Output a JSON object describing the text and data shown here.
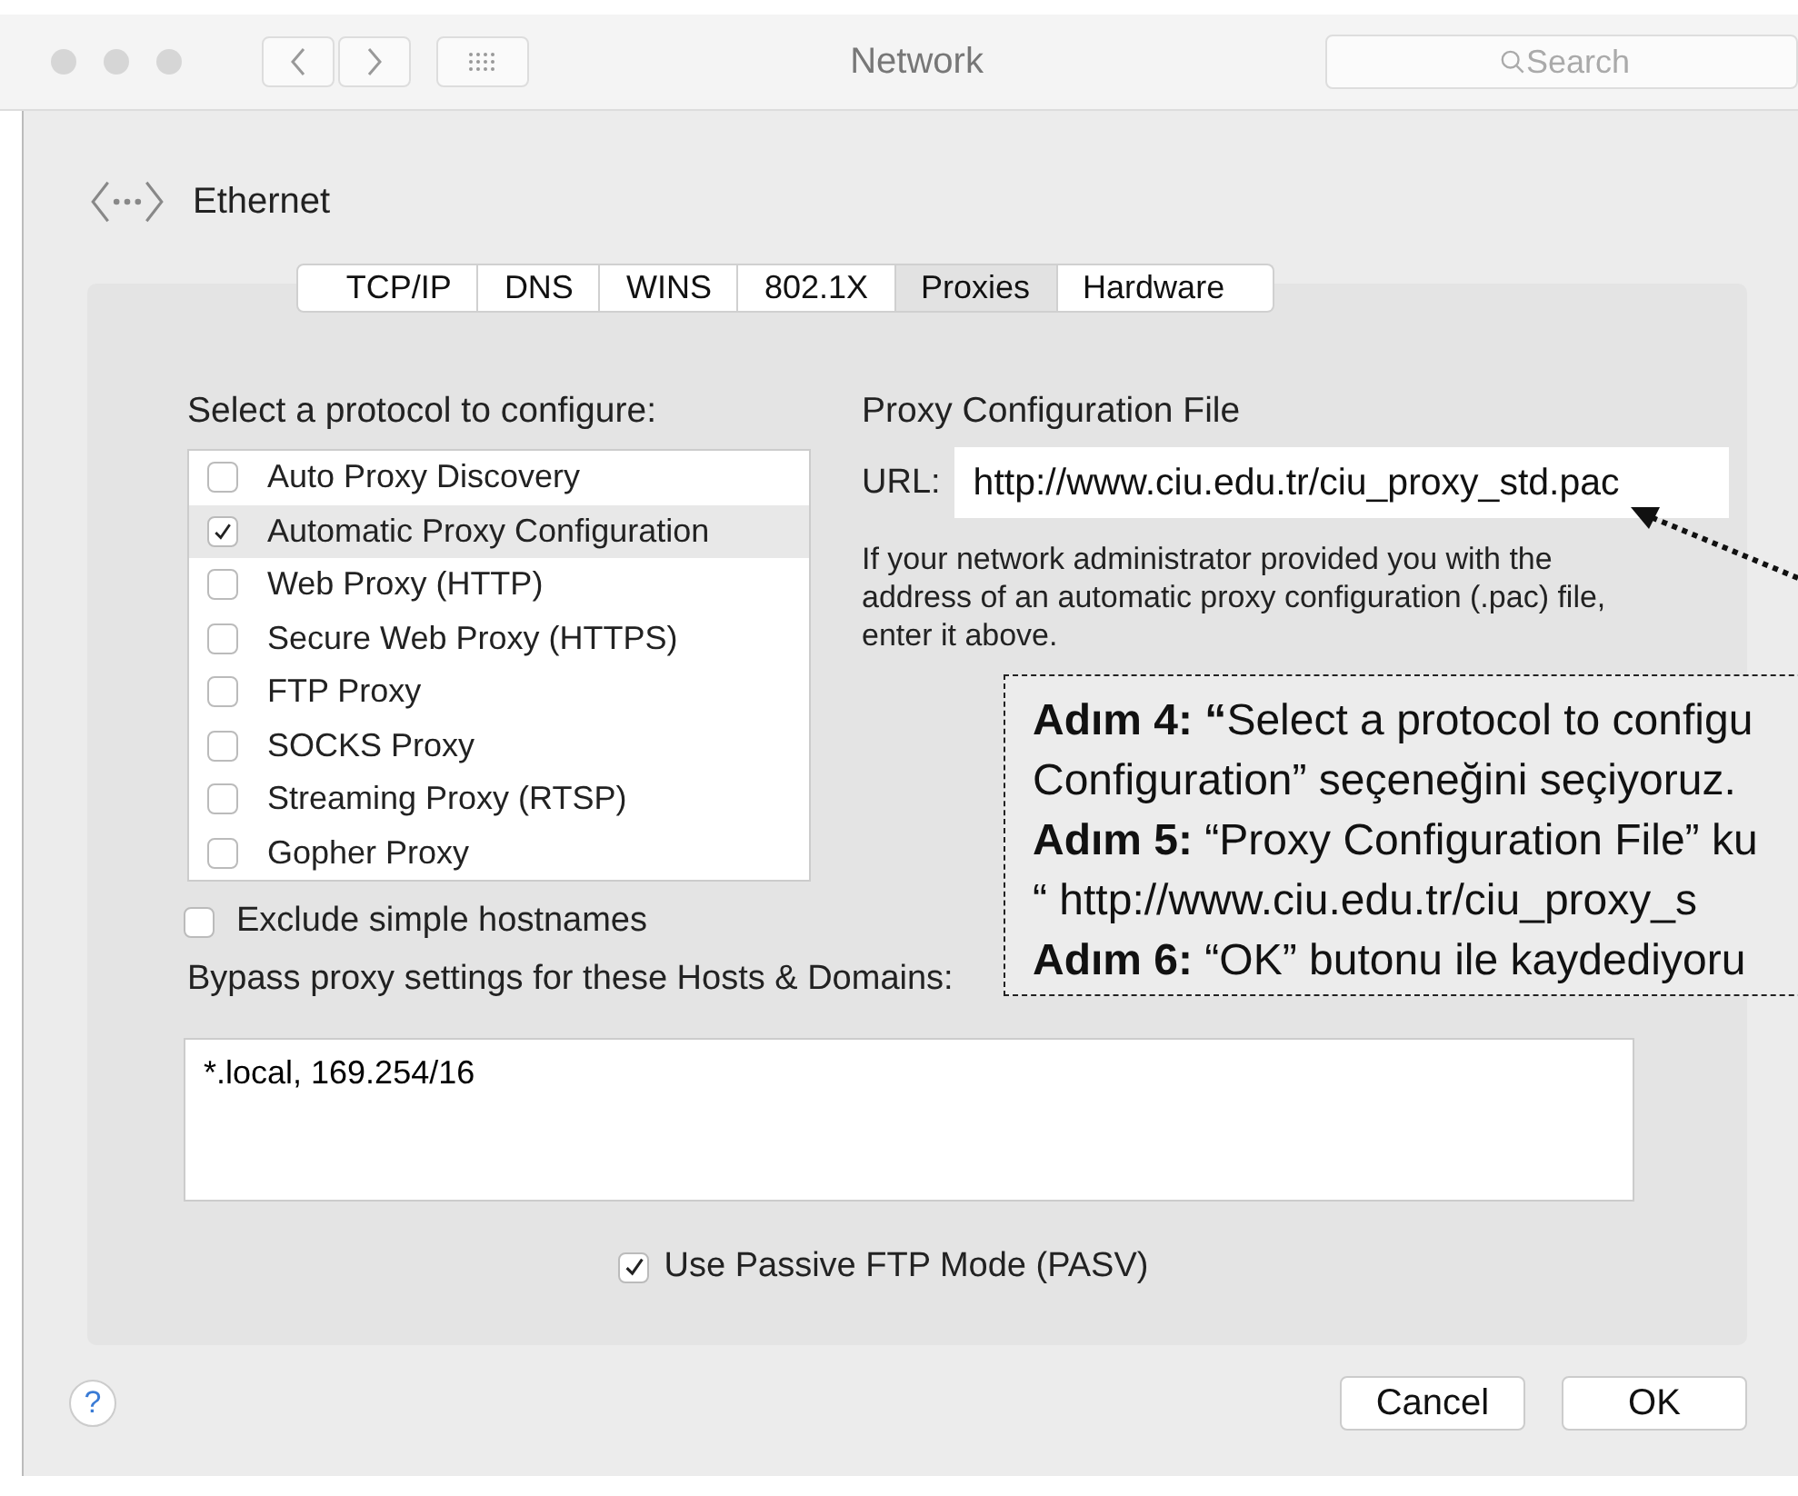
{
  "window": {
    "title": "Network"
  },
  "search": {
    "placeholder": "Search"
  },
  "interface": {
    "name": "Ethernet"
  },
  "tabs": [
    {
      "label": "TCP/IP",
      "selected": false
    },
    {
      "label": "DNS",
      "selected": false
    },
    {
      "label": "WINS",
      "selected": false
    },
    {
      "label": "802.1X",
      "selected": false
    },
    {
      "label": "Proxies",
      "selected": true
    },
    {
      "label": "Hardware",
      "selected": false
    }
  ],
  "protocols": {
    "heading": "Select a protocol to configure:",
    "items": [
      {
        "label": "Auto Proxy Discovery",
        "checked": false,
        "selected": false
      },
      {
        "label": "Automatic Proxy Configuration",
        "checked": true,
        "selected": true
      },
      {
        "label": "Web Proxy (HTTP)",
        "checked": false,
        "selected": false
      },
      {
        "label": "Secure Web Proxy (HTTPS)",
        "checked": false,
        "selected": false
      },
      {
        "label": "FTP Proxy",
        "checked": false,
        "selected": false
      },
      {
        "label": "SOCKS Proxy",
        "checked": false,
        "selected": false
      },
      {
        "label": "Streaming Proxy (RTSP)",
        "checked": false,
        "selected": false
      },
      {
        "label": "Gopher Proxy",
        "checked": false,
        "selected": false
      }
    ]
  },
  "config": {
    "heading": "Proxy Configuration File",
    "url_label": "URL:",
    "url": "http://www.ciu.edu.tr/ciu_proxy_std.pac",
    "hint": "If your network administrator provided you with the address of an automatic proxy configuration (.pac) file, enter it above."
  },
  "exclude_simple": {
    "label": "Exclude simple hostnames",
    "checked": false
  },
  "bypass": {
    "label": "Bypass proxy settings for these Hosts & Domains:",
    "value": "*.local, 169.254/16"
  },
  "passive_ftp": {
    "label": "Use Passive FTP Mode (PASV)",
    "checked": true
  },
  "help": {
    "label": "?"
  },
  "buttons": [
    "Cancel",
    "OK"
  ],
  "annotation": {
    "lines": [
      "**Adım 4: “**Select a protocol to configu",
      "Configuration” seçeneğini seçiyoruz.",
      "**Adım 5:** “Proxy Configuration File” ku",
      "“ http://www.ciu.edu.tr/ciu_proxy_s",
      "**Adım 6:** “OK” butonu ile kaydediyoru"
    ]
  }
}
